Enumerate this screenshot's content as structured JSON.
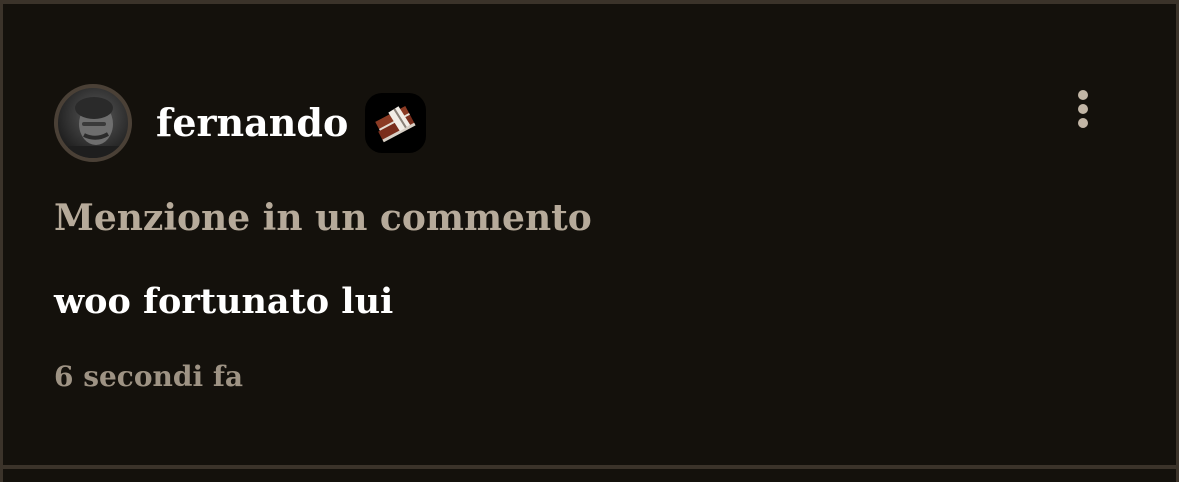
{
  "notification": {
    "username": "fernando",
    "type_label": "Menzione in un commento",
    "comment_text": "woo fortunato lui",
    "timestamp": "6 secondi fa"
  },
  "icons": {
    "avatar": "user-avatar-photo",
    "badge": "stack-of-books-badge-icon",
    "menu": "more-vertical-icon"
  },
  "colors": {
    "background": "#14110c",
    "border": "#3b332a",
    "primary_text": "#ffffff",
    "secondary_text": "#b6aa9a",
    "muted_text": "#9e9384"
  }
}
